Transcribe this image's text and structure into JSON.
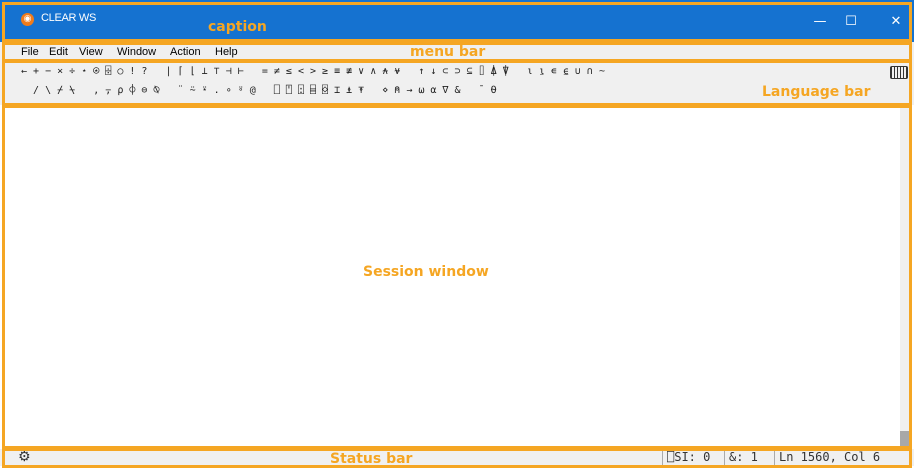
{
  "caption": {
    "app_title": "CLEAR WS",
    "minimize": "—",
    "maximize": "☐",
    "close": "✕"
  },
  "menu": {
    "items": [
      "File",
      "Edit",
      "View",
      "Window",
      "Action",
      "Help"
    ]
  },
  "language_bar": {
    "row1": "← + − × ÷ ⋆ ⍟ ⌹ ○ ! ?   | ⌈ ⌊ ⊥ ⊤ ⊣ ⊢   = ≠ ≤ < > ≥ ≡ ≢ ∨ ∧ ⍲ ⍱   ↑ ↓ ⊂ ⊃ ⊆ ⌷ ⍋ ⍒   ⍳ ⍸ ∊ ⍷ ∪ ∩ ~",
    "row2": "  / \\ ⌿ ⍀   , ⍪ ⍴ ⌽ ⊖ ⍉   ¨ ⍨ ⍣ . ∘ ⍤ @   ⎕ ⍞ ⍠ ⌸ ⌺ ⌶ ⍎ ⍕   ⋄ ⍝ → ⍵ ⍺ ∇ &   ¯ ⍬",
    "keyboard_icon": "keyboard-icon"
  },
  "annotations": {
    "caption": "caption",
    "menu_bar": "menu bar",
    "language_bar": "Language bar",
    "session_window": "Session window",
    "status_bar": "Status bar"
  },
  "status": {
    "gear_icon": "gear-icon",
    "si": "⎕SI: 0",
    "amp": "&: 1",
    "position": "Ln 1560, Col 6"
  },
  "colors": {
    "caption_bg": "#1572d0",
    "annotation": "#f5a623",
    "bar_bg": "#f0f0f0"
  }
}
